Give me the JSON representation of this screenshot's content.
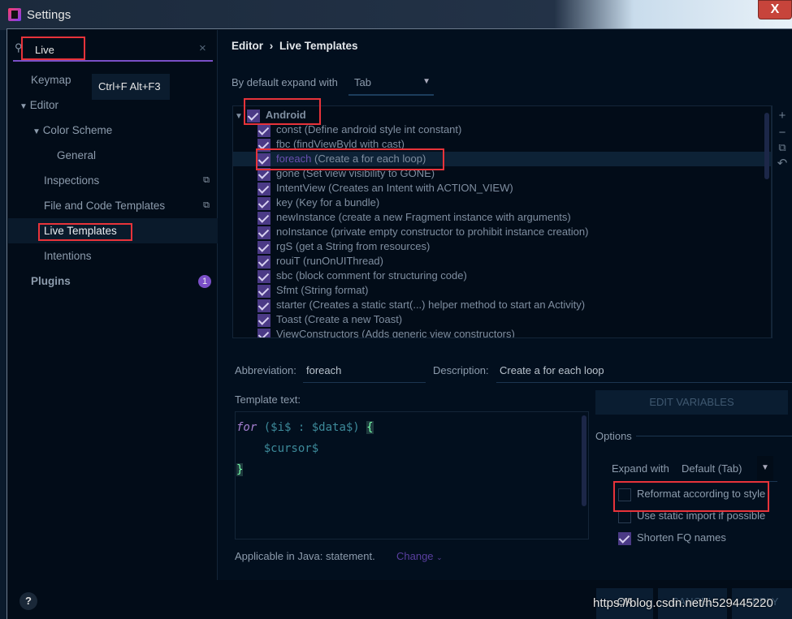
{
  "window": {
    "title": "Settings",
    "close": "X"
  },
  "search": {
    "value": "Live",
    "clear": "×",
    "shortcut": "Ctrl+F  Alt+F3"
  },
  "sidebar": {
    "items": [
      {
        "label": "Keymap"
      },
      {
        "label": "Editor"
      },
      {
        "label": "Color Scheme"
      },
      {
        "label": "General"
      },
      {
        "label": "Inspections"
      },
      {
        "label": "File and Code Templates"
      },
      {
        "label": "Live Templates"
      },
      {
        "label": "Intentions"
      },
      {
        "label": "Plugins",
        "badge": "1"
      }
    ]
  },
  "breadcrumb": {
    "parent": "Editor",
    "sep": "›",
    "current": "Live Templates"
  },
  "expand": {
    "label": "By default expand with",
    "value": "Tab"
  },
  "group": {
    "name": "Android"
  },
  "templates": [
    {
      "abbr": "const",
      "desc": "(Define android style int constant)"
    },
    {
      "abbr": "fbc",
      "desc": "(findViewByld with cast)"
    },
    {
      "abbr": "foreach",
      "desc": "(Create a for each loop)",
      "selected": true
    },
    {
      "abbr": "gone",
      "desc": "(Set view visibility to GONE)"
    },
    {
      "abbr": "IntentView",
      "desc": "(Creates an Intent with ACTION_VIEW)"
    },
    {
      "abbr": "key",
      "desc": "(Key for a bundle)"
    },
    {
      "abbr": "newInstance",
      "desc": "(create a new Fragment instance with arguments)"
    },
    {
      "abbr": "noInstance",
      "desc": "(private empty constructor to prohibit instance creation)"
    },
    {
      "abbr": "rgS",
      "desc": "(get a String from resources)"
    },
    {
      "abbr": "rouiT",
      "desc": "(runOnUIThread)"
    },
    {
      "abbr": "sbc",
      "desc": "(block comment for structuring code)"
    },
    {
      "abbr": "Sfmt",
      "desc": "(String format)"
    },
    {
      "abbr": "starter",
      "desc": "(Creates a static start(...) helper method to start an Activity)"
    },
    {
      "abbr": "Toast",
      "desc": "(Create a new Toast)"
    },
    {
      "abbr": "ViewConstructors",
      "desc": "(Adds generic view constructors)"
    }
  ],
  "tools": {
    "add": "+",
    "remove": "−",
    "copy": "⧉",
    "undo": "↶"
  },
  "detail": {
    "abbr_label": "Abbreviation:",
    "abbr_value": "foreach",
    "desc_label": "Description:",
    "desc_value": "Create a for each loop",
    "template_label": "Template text:",
    "code": {
      "kw": "for",
      "l1": " ($i$ : $data$) ",
      "brace_open": "{",
      "l2": "    $cursor$",
      "brace_close": "}"
    },
    "applicable": "Applicable in Java: statement.",
    "change": "Change"
  },
  "edit_variables": "EDIT VARIABLES",
  "options": {
    "title": "Options",
    "expand_label": "Expand with",
    "expand_value": "Default (Tab)",
    "reformat": "Reformat according to style",
    "reformat_checked": false,
    "static_import": "Use static import if possible",
    "static_import_checked": false,
    "shorten": "Shorten FQ names",
    "shorten_checked": true
  },
  "footer": {
    "help": "?",
    "ok": "OK",
    "cancel": "CANCEL",
    "apply": "APPLY",
    "watermark": "https://blog.csdn.net/h529445220"
  },
  "colors": {
    "accent": "#7a4fc7",
    "checkbox": "#4b3a86",
    "highlight": "#e8333a",
    "background": "#020f1e"
  }
}
